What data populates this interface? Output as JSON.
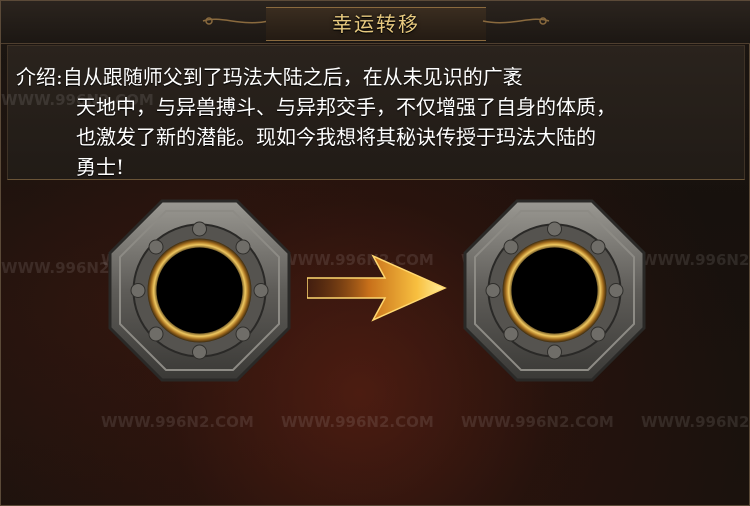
{
  "dialog": {
    "title": "幸运转移",
    "intro_text": "介绍:自从跟随师父到了玛法大陆之后，在从未见识的广袤\n天地中，与异兽搏斗、与异邦交手，不仅增强了自身的体质，\n也激发了新的潜能。现如今我想将其秘诀传授于玛法大陆的\n勇士!"
  },
  "slots": {
    "source_label": "",
    "target_label": ""
  },
  "watermark": "WWW.996N2.COM",
  "colors": {
    "title_gold": "#e7c97f",
    "frame_stone": "#6b6a66",
    "ring_gold": "#c89a3a",
    "arrow_orange": "#f0a020"
  }
}
